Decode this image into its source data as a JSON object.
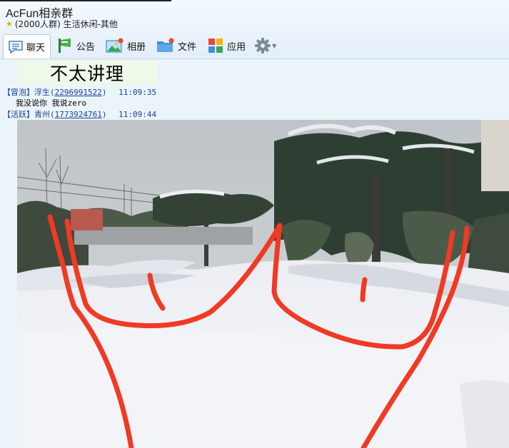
{
  "window": {
    "title": "AcFun相亲群",
    "subtitle": "(2000人群) 生活休闲-其他"
  },
  "toolbar": {
    "tabs": [
      {
        "label": "聊天",
        "icon": "chat-bubble-icon"
      },
      {
        "label": "公告",
        "icon": "megaphone-icon"
      },
      {
        "label": "相册",
        "icon": "photo-album-icon"
      },
      {
        "label": "文件",
        "icon": "folder-icon"
      },
      {
        "label": "应用",
        "icon": "apps-grid-icon"
      }
    ],
    "settings_icon": "gear-icon"
  },
  "chat": {
    "sticker_text": "不太讲理",
    "messages": [
      {
        "tag": "【冒泡】",
        "sender": "浮生",
        "qq": "2296991522",
        "time": "11:09:35",
        "text": "我没说你 我说zero"
      },
      {
        "tag": "【活跃】",
        "sender": "青州",
        "qq": "1773924761",
        "time": "11:09:44",
        "image": "snowy-park-photo-with-red-drawing"
      }
    ]
  },
  "colors": {
    "header_bg": "#e8f1fb",
    "chat_bg": "#eaf4f9",
    "sender_blue": "#1a3fa0",
    "red_drawing": "#f03a24"
  }
}
